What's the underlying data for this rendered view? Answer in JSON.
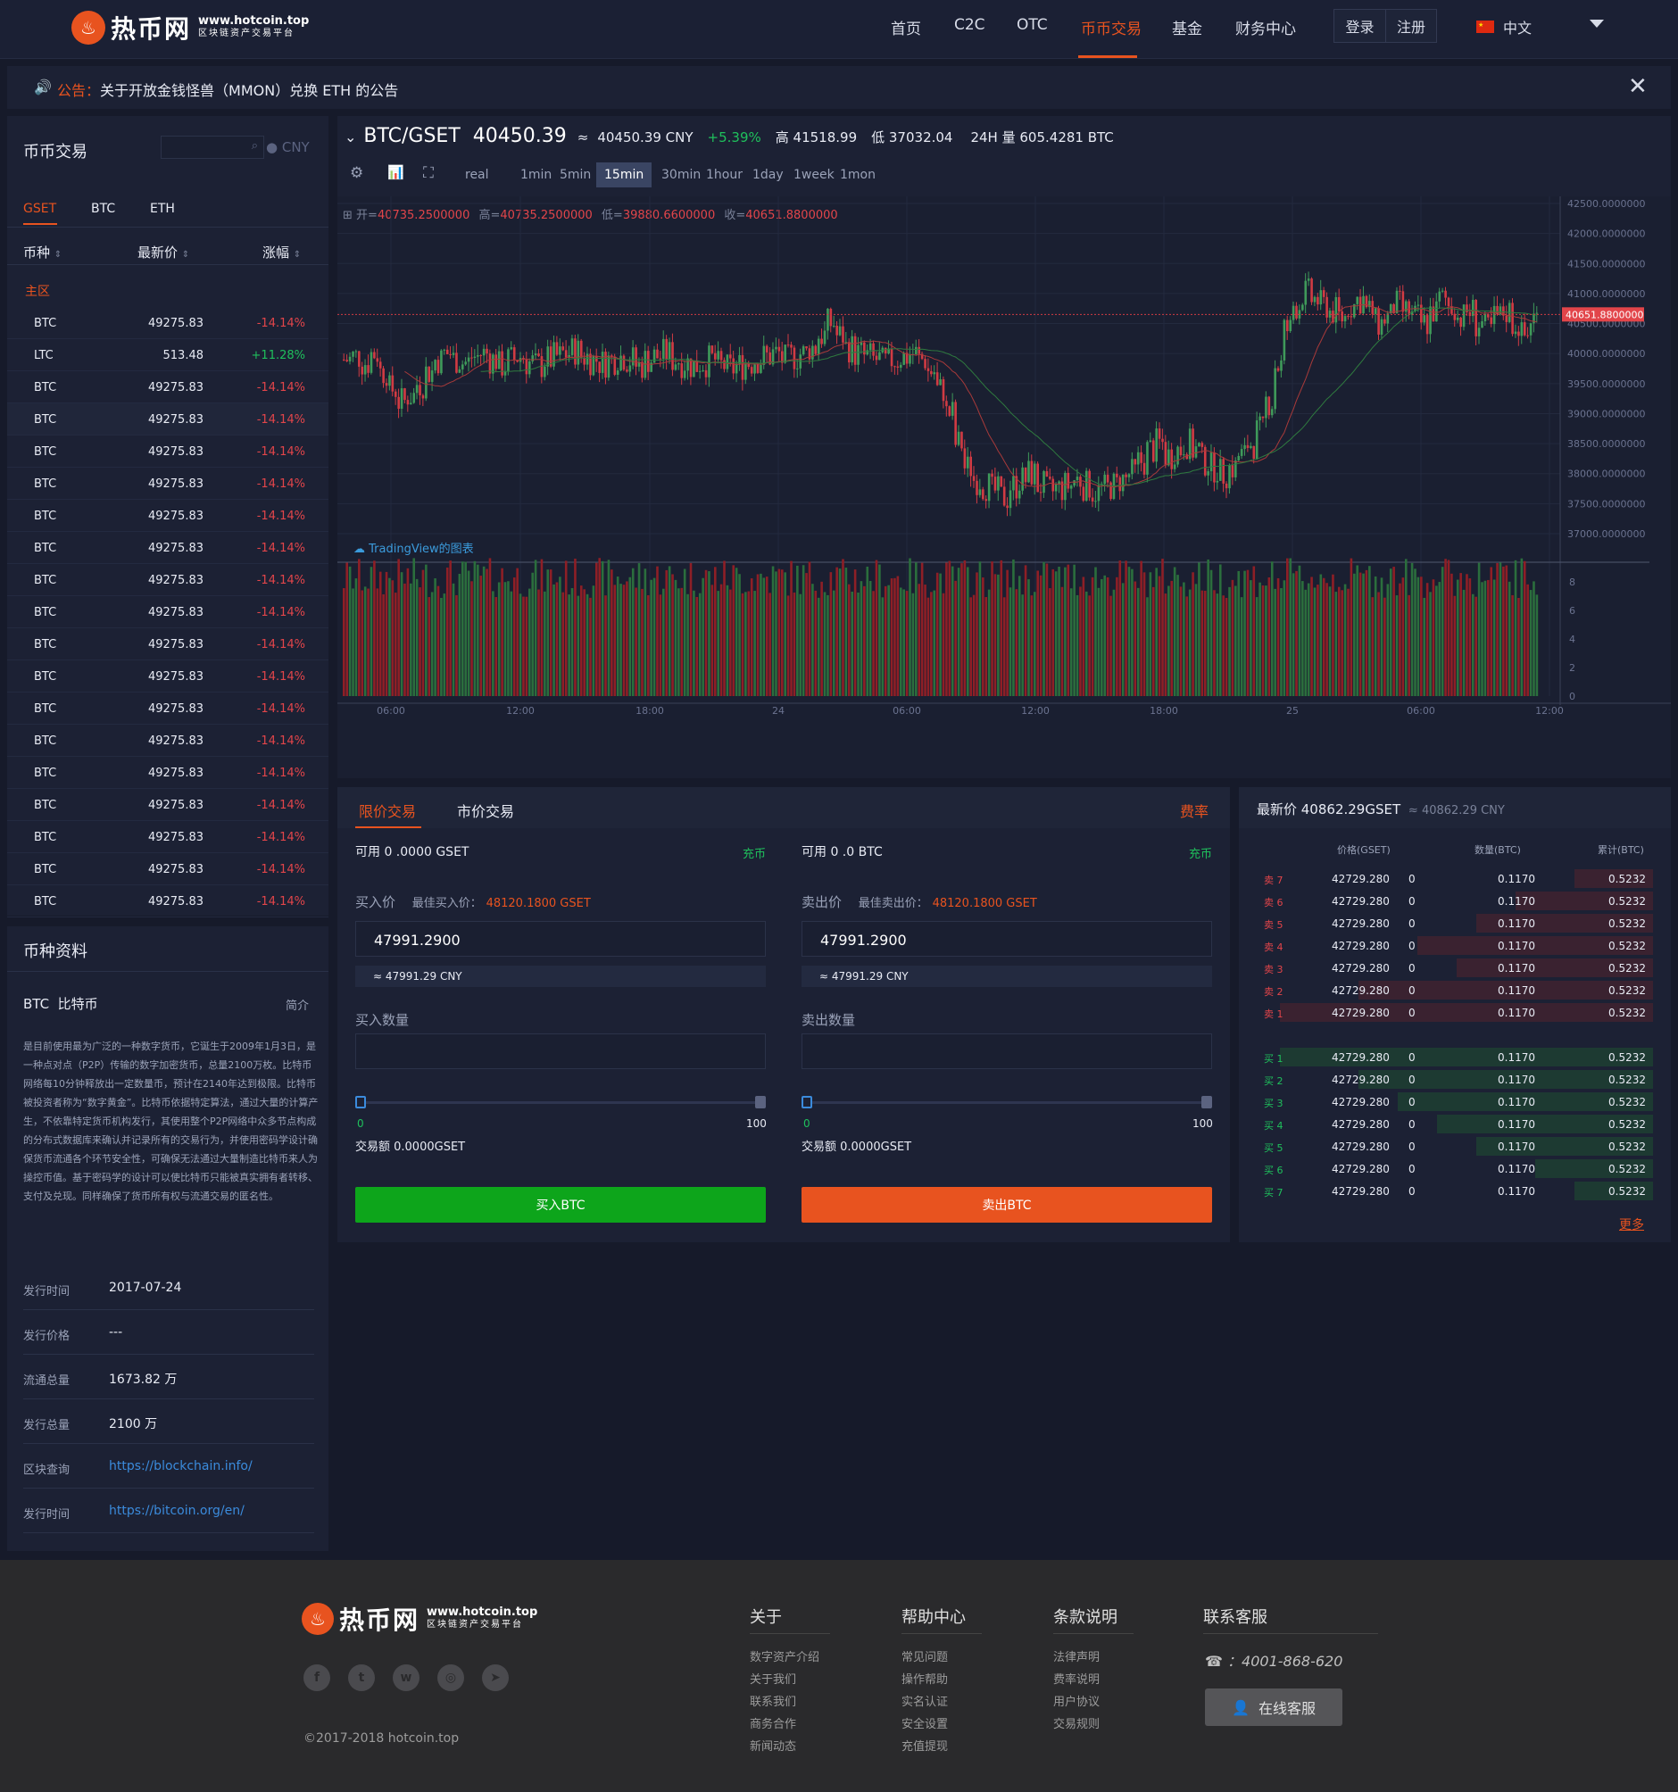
{
  "header": {
    "logo_name": "热币网",
    "logo_domain": "www.hotcoin.top",
    "logo_tagline": "区块链资产交易平台",
    "nav": [
      "首页",
      "C2C",
      "OTC",
      "币币交易",
      "基金",
      "财务中心"
    ],
    "active_nav": "币币交易",
    "login": "登录",
    "register": "注册",
    "language": "中文"
  },
  "notice": {
    "prefix": "公告：",
    "text": "关于开放金钱怪兽（MMON）兑换 ETH 的公告"
  },
  "market": {
    "title": "币币交易",
    "currency": "CNY",
    "tabs": [
      "GSET",
      "BTC",
      "ETH"
    ],
    "col_coin": "币种",
    "col_price": "最新价",
    "col_change": "涨幅",
    "zone": "主区",
    "rows": [
      {
        "coin": "BTC",
        "price": "49275.83",
        "change": "-14.14%",
        "dir": "down"
      },
      {
        "coin": "LTC",
        "price": "513.48",
        "change": "+11.28%",
        "dir": "up"
      },
      {
        "coin": "BTC",
        "price": "49275.83",
        "change": "-14.14%",
        "dir": "down"
      },
      {
        "coin": "BTC",
        "price": "49275.83",
        "change": "-14.14%",
        "dir": "down"
      },
      {
        "coin": "BTC",
        "price": "49275.83",
        "change": "-14.14%",
        "dir": "down"
      },
      {
        "coin": "BTC",
        "price": "49275.83",
        "change": "-14.14%",
        "dir": "down"
      },
      {
        "coin": "BTC",
        "price": "49275.83",
        "change": "-14.14%",
        "dir": "down"
      },
      {
        "coin": "BTC",
        "price": "49275.83",
        "change": "-14.14%",
        "dir": "down"
      },
      {
        "coin": "BTC",
        "price": "49275.83",
        "change": "-14.14%",
        "dir": "down"
      },
      {
        "coin": "BTC",
        "price": "49275.83",
        "change": "-14.14%",
        "dir": "down"
      },
      {
        "coin": "BTC",
        "price": "49275.83",
        "change": "-14.14%",
        "dir": "down"
      },
      {
        "coin": "BTC",
        "price": "49275.83",
        "change": "-14.14%",
        "dir": "down"
      },
      {
        "coin": "BTC",
        "price": "49275.83",
        "change": "-14.14%",
        "dir": "down"
      },
      {
        "coin": "BTC",
        "price": "49275.83",
        "change": "-14.14%",
        "dir": "down"
      },
      {
        "coin": "BTC",
        "price": "49275.83",
        "change": "-14.14%",
        "dir": "down"
      },
      {
        "coin": "BTC",
        "price": "49275.83",
        "change": "-14.14%",
        "dir": "down"
      },
      {
        "coin": "BTC",
        "price": "49275.83",
        "change": "-14.14%",
        "dir": "down"
      },
      {
        "coin": "BTC",
        "price": "49275.83",
        "change": "-14.14%",
        "dir": "down"
      },
      {
        "coin": "BTC",
        "price": "49275.83",
        "change": "-14.14%",
        "dir": "down"
      }
    ]
  },
  "coin_info": {
    "title": "币种资料",
    "name": "BTC  比特币",
    "intro_link": "简介",
    "description": "是目前使用最为广泛的一种数字货币，它诞生于2009年1月3日，是一种点对点（P2P）传输的数字加密货币，总量2100万枚。比特币网络每10分钟释放出一定数量币，预计在2140年达到极限。比特币被投资者称为“数字黄金”。比特币依据特定算法，通过大量的计算产生，不依靠特定货币机构发行，其使用整个P2P网络中众多节点构成的分布式数据库来确认并记录所有的交易行为，并使用密码学设计确保货币流通各个环节安全性，可确保无法通过大量制造比特币来人为操控币值。基于密码学的设计可以使比特币只能被真实拥有者转移、支付及兑现。同样确保了货币所有权与流通交易的匿名性。",
    "rows": [
      {
        "label": "发行时间",
        "value": "2017-07-24",
        "link": false
      },
      {
        "label": "发行价格",
        "value": "---",
        "link": false
      },
      {
        "label": "流通总量",
        "value": "1673.82 万",
        "link": false
      },
      {
        "label": "发行总量",
        "value": "2100 万",
        "link": false
      },
      {
        "label": "区块查询",
        "value": "https://blockchain.info/",
        "link": true
      },
      {
        "label": "发行时间",
        "value": "https://bitcoin.org/en/",
        "link": true
      }
    ]
  },
  "ticker": {
    "pair": "BTC/GSET",
    "price": "40450.39",
    "approx": "≈",
    "cny": "40450.39 CNY",
    "change": "+5.39%",
    "high": "高 41518.99",
    "low": "低 37032.04",
    "volume": "24H 量 605.4281 BTC"
  },
  "intervals": [
    "real",
    "1min",
    "5min",
    "15min",
    "30min",
    "1hour",
    "1day",
    "1week",
    "1mon"
  ],
  "active_interval": "15min",
  "ohlc": {
    "open_label": "开=",
    "open": "40735.2500000",
    "high_label": "高=",
    "high": "40735.2500000",
    "low_label": "低=",
    "low": "39880.6600000",
    "close_label": "收=",
    "close": "40651.8800000"
  },
  "watermark": "TradingView的图表",
  "chart_data": {
    "type": "candlestick",
    "price_axis": [
      "42500.0000000",
      "42000.0000000",
      "41500.0000000",
      "41000.0000000",
      "40500.0000000",
      "40000.0000000",
      "39500.0000000",
      "39000.0000000",
      "38500.0000000",
      "38000.0000000",
      "37500.0000000",
      "37000.0000000"
    ],
    "ylim": [
      37000,
      42500
    ],
    "last_price": "40651.8800000",
    "last_price_value": 40651.88,
    "volume_axis": [
      "8",
      "6",
      "4",
      "2",
      "0"
    ],
    "volume_ylim": [
      0,
      8
    ],
    "time_axis": [
      "06:00",
      "12:00",
      "18:00",
      "24",
      "06:00",
      "12:00",
      "18:00",
      "25",
      "06:00",
      "12:00"
    ],
    "price_path": [
      39900,
      39950,
      39850,
      40000,
      39700,
      39400,
      39200,
      39300,
      39500,
      39700,
      39900,
      40000,
      39900,
      39850,
      39950,
      40000,
      39900,
      39800,
      39900,
      39950,
      39850,
      39800,
      39900,
      39950,
      40000,
      40050,
      39950,
      39900,
      39850,
      39900,
      39950,
      39900,
      39800,
      39900,
      39950,
      40000,
      39900,
      39850,
      39800,
      39850,
      39900,
      39800,
      39750,
      39800,
      39850,
      39900,
      39950,
      40000,
      39900,
      39950,
      40000,
      40100,
      40300,
      40500,
      40300,
      40100,
      40000,
      39950,
      39900,
      39850,
      39900,
      39950,
      40000,
      39900,
      39700,
      39400,
      39000,
      38500,
      38100,
      37900,
      37800,
      37700,
      37600,
      37800,
      37900,
      38000,
      37800,
      37700,
      37750,
      37800,
      37900,
      37800,
      37700,
      37750,
      37800,
      37900,
      38000,
      38200,
      38400,
      38500,
      38300,
      38400,
      38500,
      38400,
      38200,
      38100,
      38000,
      38100,
      38300,
      38500,
      38700,
      39200,
      39800,
      40400,
      40800,
      41000,
      40900,
      40800,
      40700,
      40600,
      40800,
      40900,
      40700,
      40500,
      40600,
      40800,
      40700,
      40600,
      40500,
      40700,
      40900,
      40800,
      40600,
      40700,
      40500,
      40400,
      40600,
      40700,
      40500,
      40300,
      40600
    ]
  },
  "trade": {
    "tab_limit": "限价交易",
    "tab_market": "市价交易",
    "fee": "费率",
    "buy": {
      "available": "可用 0 .0000 GSET",
      "deposit": "充币",
      "price_label": "买入价",
      "best_label": "最佳买入价：",
      "best_value": "48120.1800 GSET",
      "price_value": "47991.2900",
      "approx": "≈ 47991.29 CNY",
      "amount_label": "买入数量",
      "slider_min": "0",
      "slider_max": "100",
      "total": "交易额 0.0000GSET",
      "button": "买入BTC"
    },
    "sell": {
      "available": "可用 0 .0 BTC",
      "deposit": "充币",
      "price_label": "卖出价",
      "best_label": "最佳卖出价：",
      "best_value": "48120.1800 GSET",
      "price_value": "47991.2900",
      "approx": "≈ 47991.29 CNY",
      "amount_label": "卖出数量",
      "slider_min": "0",
      "slider_max": "100",
      "total": "交易额 0.0000GSET",
      "button": "卖出BTC"
    }
  },
  "orderbook": {
    "last_label": "最新价 40862.29GSET",
    "last_cny": "≈ 40862.29 CNY",
    "col_price": "价格(GSET)",
    "col_amount": "数量(BTC)",
    "col_total": "累计(BTC)",
    "asks": [
      {
        "label": "卖 7",
        "price": "42729.280",
        "zero": "0",
        "amount": "0.1170",
        "total": "0.5232",
        "depth": 0.2
      },
      {
        "label": "卖 6",
        "price": "42729.280",
        "zero": "0",
        "amount": "0.1170",
        "total": "0.5232",
        "depth": 0.35
      },
      {
        "label": "卖 5",
        "price": "42729.280",
        "zero": "0",
        "amount": "0.1170",
        "total": "0.5232",
        "depth": 0.45
      },
      {
        "label": "卖 4",
        "price": "42729.280",
        "zero": "0",
        "amount": "0.1170",
        "total": "0.5232",
        "depth": 0.6
      },
      {
        "label": "卖 3",
        "price": "42729.280",
        "zero": "0",
        "amount": "0.1170",
        "total": "0.5232",
        "depth": 0.5
      },
      {
        "label": "卖 2",
        "price": "42729.280",
        "zero": "0",
        "amount": "0.1170",
        "total": "0.5232",
        "depth": 0.75
      },
      {
        "label": "卖 1",
        "price": "42729.280",
        "zero": "0",
        "amount": "0.1170",
        "total": "0.5232",
        "depth": 0.95
      }
    ],
    "bids": [
      {
        "label": "买 1",
        "price": "42729.280",
        "zero": "0",
        "amount": "0.1170",
        "total": "0.5232",
        "depth": 0.95
      },
      {
        "label": "买 2",
        "price": "42729.280",
        "zero": "0",
        "amount": "0.1170",
        "total": "0.5232",
        "depth": 0.75
      },
      {
        "label": "买 3",
        "price": "42729.280",
        "zero": "0",
        "amount": "0.1170",
        "total": "0.5232",
        "depth": 0.65
      },
      {
        "label": "买 4",
        "price": "42729.280",
        "zero": "0",
        "amount": "0.1170",
        "total": "0.5232",
        "depth": 0.55
      },
      {
        "label": "买 5",
        "price": "42729.280",
        "zero": "0",
        "amount": "0.1170",
        "total": "0.5232",
        "depth": 0.45
      },
      {
        "label": "买 6",
        "price": "42729.280",
        "zero": "0",
        "amount": "0.1170",
        "total": "0.5232",
        "depth": 0.3
      },
      {
        "label": "买 7",
        "price": "42729.280",
        "zero": "0",
        "amount": "0.1170",
        "total": "0.5232",
        "depth": 0.2
      }
    ],
    "more": "更多"
  },
  "footer": {
    "logo_name": "热币网",
    "logo_domain": "www.hotcoin.top",
    "logo_tagline": "区块链资产交易平台",
    "copyright": "©2017-2018 hotcoin.top",
    "cols": [
      {
        "title": "关于",
        "links": [
          "数字资产介绍",
          "关于我们",
          "联系我们",
          "商务合作",
          "新闻动态"
        ]
      },
      {
        "title": "帮助中心",
        "links": [
          "常见问题",
          "操作帮助",
          "实名认证",
          "安全设置",
          "充值提现"
        ]
      },
      {
        "title": "条款说明",
        "links": [
          "法律声明",
          "费率说明",
          "用户协议",
          "交易规则"
        ]
      }
    ],
    "contact_title": "联系客服",
    "phone": "：4001-868-620",
    "online_service": "在线客服"
  },
  "colors": {
    "accent": "#e8531f",
    "up": "#1fc05c",
    "down": "#e2454a",
    "buy_button": "#0da51b",
    "sell_button": "#e8531f"
  }
}
